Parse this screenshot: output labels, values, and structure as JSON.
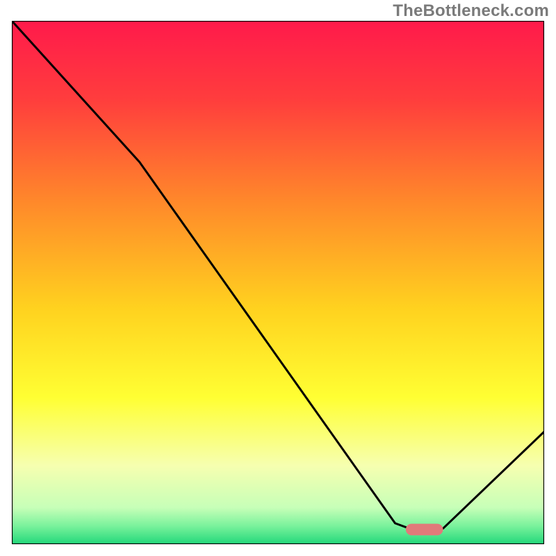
{
  "watermark": "TheBottleneck.com",
  "chart_data": {
    "type": "line",
    "title": "",
    "xlabel": "",
    "ylabel": "",
    "xlim": [
      0,
      1000
    ],
    "ylim": [
      0,
      1000
    ],
    "axes_visible": false,
    "grid": false,
    "legend": false,
    "gradient_stops": [
      {
        "offset": 0.0,
        "color": "#ff1a4b"
      },
      {
        "offset": 0.15,
        "color": "#ff3d3d"
      },
      {
        "offset": 0.35,
        "color": "#ff8a2a"
      },
      {
        "offset": 0.55,
        "color": "#ffd21f"
      },
      {
        "offset": 0.72,
        "color": "#ffff33"
      },
      {
        "offset": 0.85,
        "color": "#f6ffb0"
      },
      {
        "offset": 0.93,
        "color": "#c7ffb8"
      },
      {
        "offset": 0.965,
        "color": "#7af29c"
      },
      {
        "offset": 1.0,
        "color": "#22d77a"
      }
    ],
    "green_band": {
      "y_from": 965,
      "y_to": 1000,
      "color": "#22d77a"
    },
    "pale_band": {
      "y_from": 820,
      "y_to": 965
    },
    "series": [
      {
        "name": "curve",
        "stroke": "#000000",
        "stroke_width": 4,
        "points": [
          {
            "x": 0,
            "y": 0
          },
          {
            "x": 240,
            "y": 270
          },
          {
            "x": 720,
            "y": 960
          },
          {
            "x": 760,
            "y": 975
          },
          {
            "x": 810,
            "y": 970
          },
          {
            "x": 1000,
            "y": 785
          }
        ]
      }
    ],
    "marker": {
      "x": 775,
      "y": 972,
      "width": 70,
      "height": 22,
      "rx": 11,
      "fill": "#e17a7a"
    },
    "border": {
      "stroke": "#000000",
      "stroke_width": 3
    }
  }
}
